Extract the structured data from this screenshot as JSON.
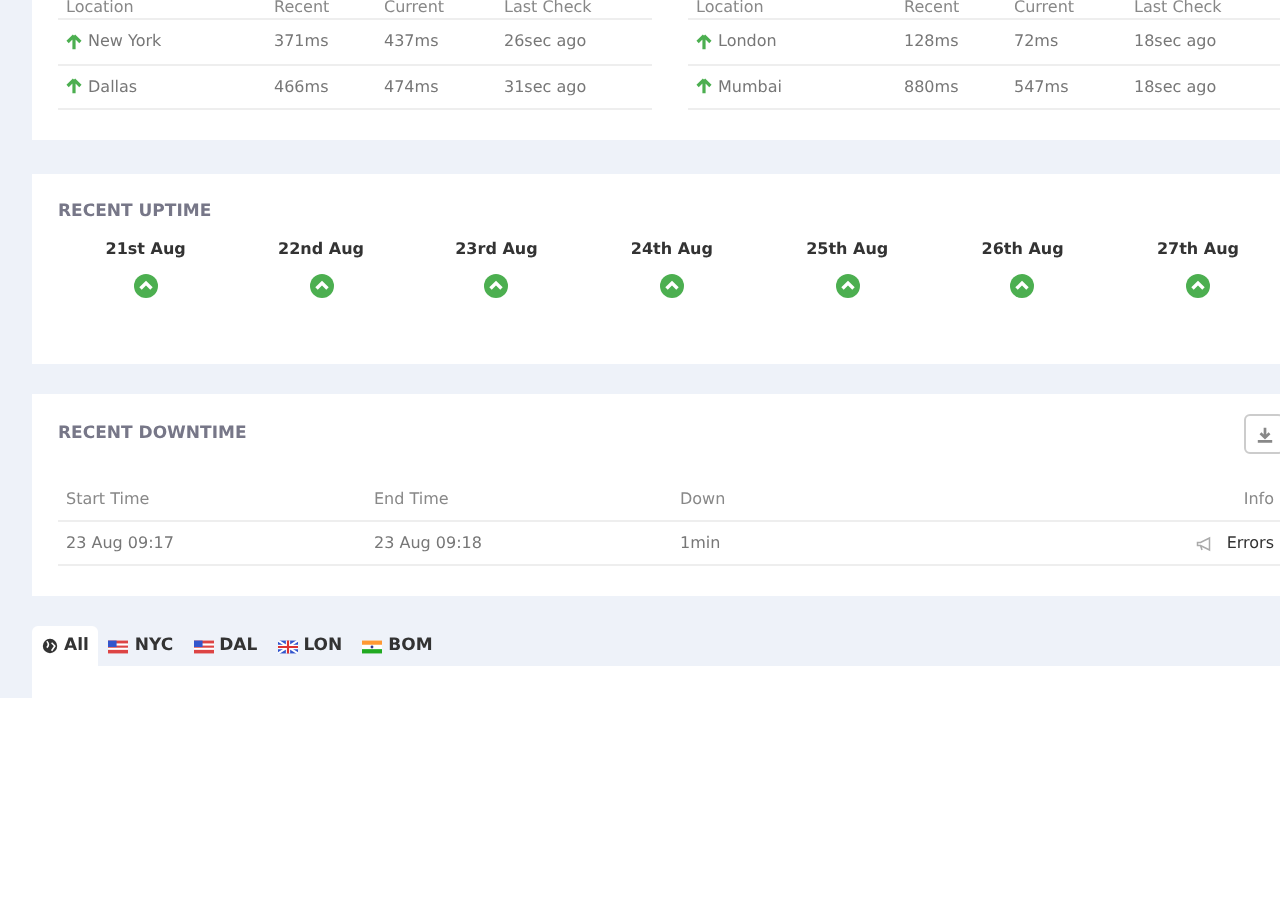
{
  "locations": {
    "tables": [
      {
        "columns": [
          "Location",
          "Recent",
          "Current",
          "Last Check"
        ],
        "rows": [
          {
            "up": true,
            "location": "New York",
            "recent": "371ms",
            "current": "437ms",
            "last_check": "26sec ago"
          },
          {
            "up": true,
            "location": "Dallas",
            "recent": "466ms",
            "current": "474ms",
            "last_check": "31sec ago"
          }
        ]
      },
      {
        "columns": [
          "Location",
          "Recent",
          "Current",
          "Last Check"
        ],
        "rows": [
          {
            "up": true,
            "location": "London",
            "recent": "128ms",
            "current": "72ms",
            "last_check": "18sec ago"
          },
          {
            "up": true,
            "location": "Mumbai",
            "recent": "880ms",
            "current": "547ms",
            "last_check": "18sec ago"
          }
        ]
      }
    ]
  },
  "recent_uptime": {
    "title": "RECENT UPTIME",
    "days": [
      {
        "label": "21st Aug",
        "up": true
      },
      {
        "label": "22nd Aug",
        "up": true
      },
      {
        "label": "23rd Aug",
        "up": true
      },
      {
        "label": "24th Aug",
        "up": true
      },
      {
        "label": "25th Aug",
        "up": true
      },
      {
        "label": "26th Aug",
        "up": true
      },
      {
        "label": "27th Aug",
        "up": true
      }
    ]
  },
  "recent_downtime": {
    "title": "RECENT DOWNTIME",
    "columns": [
      "Start Time",
      "End Time",
      "Down",
      "Info"
    ],
    "rows": [
      {
        "start": "23 Aug 09:17",
        "end": "23 Aug 09:18",
        "down": "1min",
        "info": "Errors"
      }
    ]
  },
  "tabs": [
    {
      "label": "All",
      "kind": "globe",
      "selected": true
    },
    {
      "label": "NYC",
      "kind": "us",
      "selected": false
    },
    {
      "label": "DAL",
      "kind": "us",
      "selected": false
    },
    {
      "label": "LON",
      "kind": "uk",
      "selected": false
    },
    {
      "label": "BOM",
      "kind": "in",
      "selected": false
    }
  ]
}
